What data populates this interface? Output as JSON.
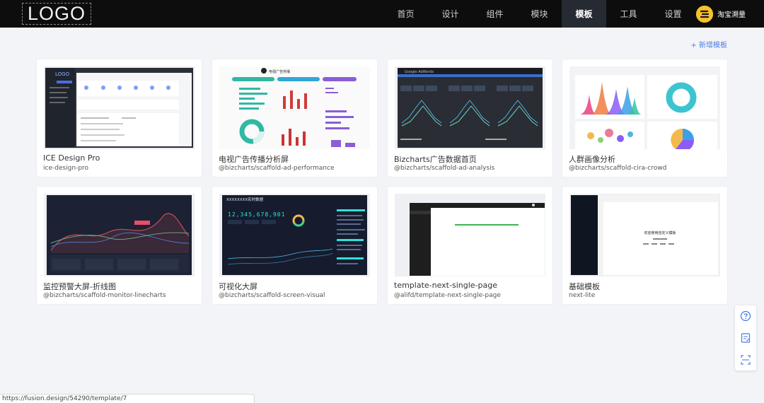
{
  "header": {
    "logo": "LOGO",
    "nav": [
      "首页",
      "设计",
      "组件",
      "模块",
      "模板",
      "工具",
      "设置"
    ],
    "active_nav": "模板",
    "user": {
      "name": "淘宝溯量",
      "avatar_icon": "brand-avatar-icon"
    }
  },
  "add_template_label": "+ 新增模板",
  "templates": [
    {
      "title": "ICE Design Pro",
      "subtitle": "ice-design-pro",
      "thumb": "admin-dashboard"
    },
    {
      "title": "电视广告传播分析屏",
      "subtitle": "@bizcharts/scaffold-ad-performance",
      "thumb": "ad-performance",
      "thumb_text": "电视广告传播"
    },
    {
      "title": "Bizcharts广告数据首页",
      "subtitle": "@bizcharts/scaffold-ad-analysis",
      "thumb": "ad-analysis",
      "thumb_text": "Google AdWords"
    },
    {
      "title": "人群画像分析",
      "subtitle": "@bizcharts/scaffold-cira-crowd",
      "thumb": "crowd"
    },
    {
      "title": "监控预警大屏-折线图",
      "subtitle": "@bizcharts/scaffold-monitor-linecharts",
      "thumb": "monitor"
    },
    {
      "title": "可视化大屏",
      "subtitle": "@bizcharts/scaffold-screen-visual",
      "thumb": "screen-visual",
      "thumb_text": "XXXXXXXX实时数据",
      "thumb_number": "12,345,678,901"
    },
    {
      "title": "template-next-single-page",
      "subtitle": "@alifd/template-next-single-page",
      "thumb": "single-page"
    },
    {
      "title": "基础模板",
      "subtitle": "next-lite",
      "thumb": "basic",
      "thumb_text": "欢迎使用自定义模板"
    }
  ],
  "side_tools": [
    "help-icon",
    "feedback-icon",
    "scan-icon"
  ],
  "status_url": "https://fusion.design/54290/template/7",
  "colors": {
    "header_bg": "#0d0d0d",
    "active_nav_bg": "#262b33",
    "accent": "#4a7dea",
    "page_bg": "#f3f4f7"
  }
}
